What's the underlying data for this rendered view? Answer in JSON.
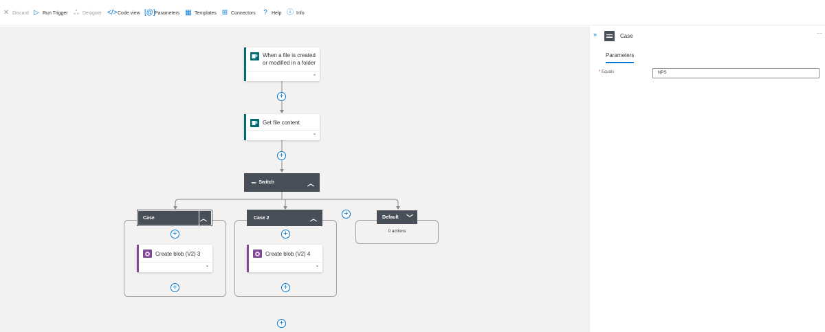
{
  "toolbar": {
    "discard": "Discard",
    "run_trigger": "Run Trigger",
    "designer": "Designer",
    "code_view": "Code view",
    "parameters": "Parameters",
    "templates": "Templates",
    "connectors": "Connectors",
    "help": "Help",
    "info": "Info"
  },
  "canvas": {
    "trigger": {
      "title_line1": "When a file is created",
      "title_line2": "or modified in a folder"
    },
    "get_file": {
      "title": "Get file content"
    },
    "switch": {
      "label": "Switch"
    },
    "case1": {
      "label": "Case",
      "action": "Create blob (V2) 3"
    },
    "case2": {
      "label": "Case 2",
      "action": "Create blob (V2) 4"
    },
    "default": {
      "label": "Default",
      "empty": "0 actions"
    }
  },
  "panel": {
    "title": "Case",
    "tab": "Parameters",
    "equals_label": "Equals",
    "equals_value": "NPS"
  },
  "colors": {
    "accent": "#0078d4",
    "sharepoint": "#036c70",
    "blob": "#804998",
    "control_header": "#484f58",
    "canvas_bg": "#f3f2f1"
  }
}
